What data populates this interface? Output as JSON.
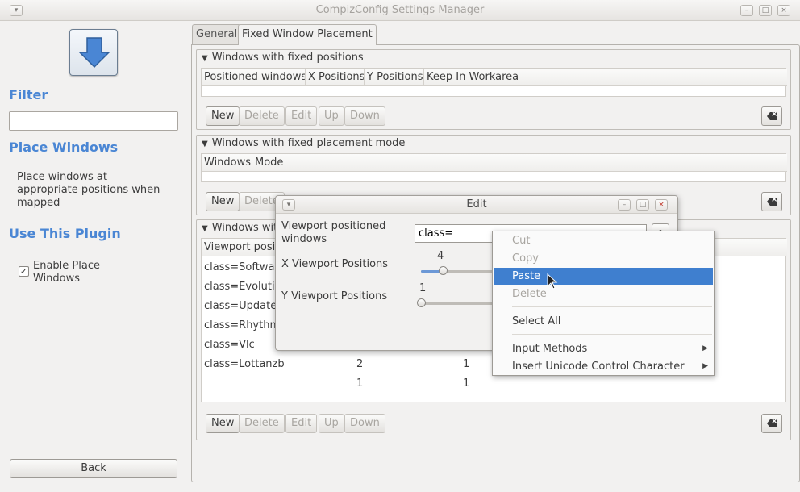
{
  "window": {
    "title": "CompizConfig Settings Manager"
  },
  "sidebar": {
    "filter_heading": "Filter",
    "filter_value": "",
    "plugin_heading": "Place Windows",
    "plugin_description": "Place windows at appropriate positions when mapped",
    "use_heading": "Use This Plugin",
    "enable_label": "Enable Place Windows",
    "enable_checked": true,
    "back_label": "Back"
  },
  "tabs": [
    {
      "label": "General",
      "active": false
    },
    {
      "label": "Fixed Window Placement",
      "active": true
    }
  ],
  "sections": [
    {
      "title": "Windows with fixed positions",
      "columns": [
        "Positioned windows",
        "X Positions",
        "Y Positions",
        "Keep In Workarea"
      ]
    },
    {
      "title": "Windows with fixed placement mode",
      "columns": [
        "Windows",
        "Mode"
      ]
    },
    {
      "title": "Windows with fixed viewport",
      "title_visible": "Windows wit",
      "columns": [
        "Viewport positioned windows",
        "X Viewport Positions",
        "Y Viewport Positions"
      ],
      "column_visible": "Viewport posit",
      "rows": [
        {
          "cls": "class=Software",
          "x": "",
          "y": ""
        },
        {
          "cls": "class=Evolutio",
          "x": "",
          "y": ""
        },
        {
          "cls": "class=Update-",
          "x": "",
          "y": ""
        },
        {
          "cls": "class=Rhythmb",
          "x": "",
          "y": ""
        },
        {
          "cls": "class=Vlc",
          "x": "",
          "y": ""
        },
        {
          "cls": "class=Lottanzb",
          "x": "2",
          "y": "1"
        },
        {
          "cls": "",
          "x": "1",
          "y": "1"
        }
      ]
    }
  ],
  "list_buttons": {
    "new": "New",
    "delete": "Delete",
    "edit": "Edit",
    "up": "Up",
    "down": "Down"
  },
  "edit_dialog": {
    "title": "Edit",
    "viewport_label": "Viewport positioned windows",
    "viewport_value": "class=",
    "x_label": "X Viewport Positions",
    "x_value": "4",
    "x_fraction": 0.3,
    "y_label": "Y Viewport Positions",
    "y_value": "1",
    "y_fraction": 0.0
  },
  "context_menu": {
    "items": [
      {
        "label": "Cut",
        "enabled": false
      },
      {
        "label": "Copy",
        "enabled": false
      },
      {
        "label": "Paste",
        "enabled": true,
        "highlighted": true
      },
      {
        "label": "Delete",
        "enabled": false
      },
      {
        "label": "Select All",
        "enabled": true
      },
      {
        "label": "Input Methods",
        "enabled": true,
        "submenu": true
      },
      {
        "label": "Insert Unicode Control Character",
        "enabled": true,
        "submenu": true
      }
    ]
  },
  "colors": {
    "accent": "#4a86d4",
    "highlight": "#3f7fcf"
  }
}
